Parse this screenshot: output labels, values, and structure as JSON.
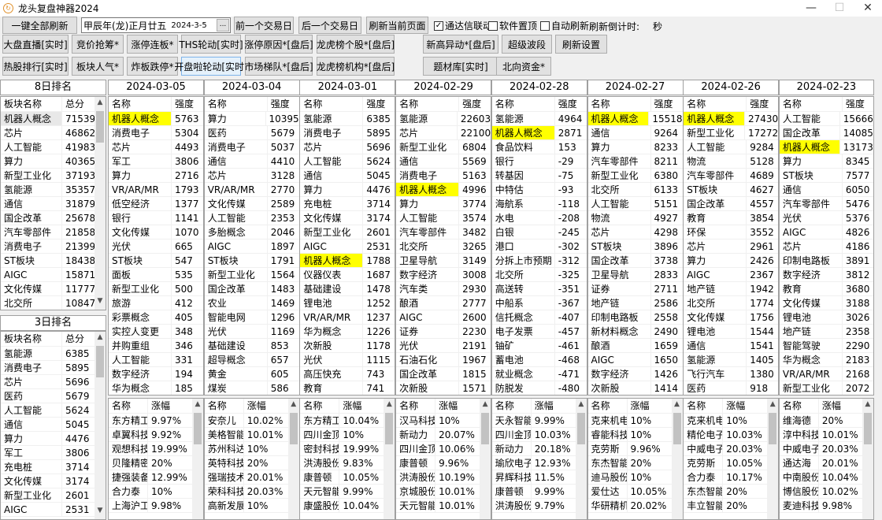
{
  "window": {
    "title": "龙头复盘神器2024",
    "icon": "app-icon",
    "minimize": "—",
    "maximize": "☐",
    "close": "✕"
  },
  "topbar": {
    "refresh_all": "一键全部刷新",
    "date_value": "甲辰年(龙)正月廿五",
    "date_small": "2024-3-5",
    "date_picker": "...",
    "prev_day": "前一个交易日",
    "next_day": "后一个交易日",
    "refresh_page": "刷新当前页面",
    "checkboxes": [
      {
        "label": "通达信联动",
        "checked": true
      },
      {
        "label": "软件置顶",
        "checked": false
      },
      {
        "label": "自动刷新",
        "checked": false
      }
    ],
    "countdown_label": "刷新倒计时:",
    "countdown_unit": "秒"
  },
  "toolbar_row1": [
    "大盘直播[实时]",
    "竞价抢筹*",
    "涨停连板*",
    "THS轮动[实时]",
    "涨停原因*[盘后]",
    "龙虎榜个股*[盘后]",
    "新高异动*[盘后]",
    "超级波段",
    "刷新设置"
  ],
  "toolbar_row2": [
    "热股排行[实时]",
    "板块人气*",
    "炸板跌停*",
    "开盘啦轮动[实时]",
    "市场梯队*[盘后]",
    "龙虎榜机构*[盘后]",
    "题材库[实时]",
    "北向资金*"
  ],
  "highlight_color": "#ffff00",
  "highlight_name": "机器人概念",
  "rank8": {
    "title": "8日排名",
    "headers": [
      "板块名称",
      "总分"
    ],
    "rows": [
      [
        "机器人概念",
        "71539"
      ],
      [
        "芯片",
        "46862"
      ],
      [
        "人工智能",
        "41983"
      ],
      [
        "算力",
        "40365"
      ],
      [
        "新型工业化",
        "37193"
      ],
      [
        "氢能源",
        "35357"
      ],
      [
        "通信",
        "31879"
      ],
      [
        "国企改革",
        "25678"
      ],
      [
        "汽车零部件",
        "21858"
      ],
      [
        "消费电子",
        "21399"
      ],
      [
        "ST板块",
        "18438"
      ],
      [
        "AIGC",
        "15871"
      ],
      [
        "文化传媒",
        "11777"
      ],
      [
        "北交所",
        "10847"
      ]
    ]
  },
  "rank3": {
    "title": "3日排名",
    "headers": [
      "板块名称",
      "总分"
    ],
    "rows": [
      [
        "氢能源",
        "6385"
      ],
      [
        "消费电子",
        "5895"
      ],
      [
        "芯片",
        "5696"
      ],
      [
        "医药",
        "5679"
      ],
      [
        "人工智能",
        "5624"
      ],
      [
        "通信",
        "5045"
      ],
      [
        "算力",
        "4476"
      ],
      [
        "军工",
        "3806"
      ],
      [
        "充电桩",
        "3714"
      ],
      [
        "文化传媒",
        "3174"
      ],
      [
        "新型工业化",
        "2601"
      ],
      [
        "AIGC",
        "2531"
      ]
    ]
  },
  "sector_headers": [
    "名称",
    "强度"
  ],
  "stock_headers": [
    "名称",
    "涨幅"
  ],
  "days": [
    {
      "date": "2024-03-05",
      "sectors": [
        [
          "机器人概念",
          "5763"
        ],
        [
          "消费电子",
          "5304"
        ],
        [
          "芯片",
          "4493"
        ],
        [
          "军工",
          "3806"
        ],
        [
          "算力",
          "2716"
        ],
        [
          "VR/AR/MR",
          "1793"
        ],
        [
          "低空经济",
          "1377"
        ],
        [
          "银行",
          "1141"
        ],
        [
          "文化传媒",
          "1070"
        ],
        [
          "光伏",
          "665"
        ],
        [
          "ST板块",
          "547"
        ],
        [
          "面板",
          "535"
        ],
        [
          "新型工业化",
          "500"
        ],
        [
          "旅游",
          "412"
        ],
        [
          "彩票概念",
          "405"
        ],
        [
          "实控人变更",
          "348"
        ],
        [
          "并购重组",
          "346"
        ],
        [
          "人工智能",
          "331"
        ],
        [
          "数字经济",
          "194"
        ],
        [
          "华为概念",
          "185"
        ]
      ],
      "stocks": [
        [
          "东方精工",
          "9.97%"
        ],
        [
          "卓翼科技",
          "9.92%"
        ],
        [
          "观想科技",
          "19.99%"
        ],
        [
          "贝隆精密",
          "20%"
        ],
        [
          "捷强装备",
          "12.99%"
        ],
        [
          "合力泰",
          "10%"
        ],
        [
          "上海沪工",
          "9.98%"
        ]
      ]
    },
    {
      "date": "2024-03-04",
      "sectors": [
        [
          "算力",
          "10395"
        ],
        [
          "医药",
          "5679"
        ],
        [
          "消费电子",
          "5037"
        ],
        [
          "通信",
          "4410"
        ],
        [
          "芯片",
          "3128"
        ],
        [
          "VR/AR/MR",
          "2770"
        ],
        [
          "文化传媒",
          "2589"
        ],
        [
          "人工智能",
          "2353"
        ],
        [
          "多胎概念",
          "2046"
        ],
        [
          "AIGC",
          "1897"
        ],
        [
          "ST板块",
          "1791"
        ],
        [
          "新型工业化",
          "1564"
        ],
        [
          "国企改革",
          "1483"
        ],
        [
          "农业",
          "1469"
        ],
        [
          "智能电网",
          "1296"
        ],
        [
          "光伏",
          "1169"
        ],
        [
          "基础建设",
          "853"
        ],
        [
          "超导概念",
          "657"
        ],
        [
          "黄金",
          "605"
        ],
        [
          "煤炭",
          "586"
        ]
      ],
      "stocks": [
        [
          "安奈儿",
          "10.02%"
        ],
        [
          "美格智能",
          "10.01%"
        ],
        [
          "苏州科达",
          "10%"
        ],
        [
          "英特科技",
          "20%"
        ],
        [
          "强瑞技术",
          "20.01%"
        ],
        [
          "荣科科技",
          "20.03%"
        ],
        [
          "高新发展",
          "10%"
        ]
      ]
    },
    {
      "date": "2024-03-01",
      "sectors": [
        [
          "氢能源",
          "6385"
        ],
        [
          "消费电子",
          "5895"
        ],
        [
          "芯片",
          "5696"
        ],
        [
          "人工智能",
          "5624"
        ],
        [
          "通信",
          "5045"
        ],
        [
          "算力",
          "4476"
        ],
        [
          "充电桩",
          "3714"
        ],
        [
          "文化传媒",
          "3174"
        ],
        [
          "新型工业化",
          "2601"
        ],
        [
          "AIGC",
          "2531"
        ],
        [
          "机器人概念",
          "1788"
        ],
        [
          "仪器仪表",
          "1687"
        ],
        [
          "基础建设",
          "1478"
        ],
        [
          "锂电池",
          "1252"
        ],
        [
          "VR/AR/MR",
          "1237"
        ],
        [
          "华为概念",
          "1226"
        ],
        [
          "次新股",
          "1178"
        ],
        [
          "光伏",
          "1115"
        ],
        [
          "高压快充",
          "743"
        ],
        [
          "教育",
          "741"
        ]
      ],
      "stocks": [
        [
          "东方精工",
          "10.04%"
        ],
        [
          "四川金顶",
          "10%"
        ],
        [
          "密封科技",
          "19.99%"
        ],
        [
          "洪涛股份",
          "9.83%"
        ],
        [
          "康普顿",
          "10.05%"
        ],
        [
          "天元智能",
          "9.99%"
        ],
        [
          "康盛股份",
          "10.04%"
        ]
      ]
    },
    {
      "date": "2024-02-29",
      "sectors": [
        [
          "氢能源",
          "22603"
        ],
        [
          "芯片",
          "22100"
        ],
        [
          "新型工业化",
          "6804"
        ],
        [
          "通信",
          "5569"
        ],
        [
          "消费电子",
          "5163"
        ],
        [
          "机器人概念",
          "4996"
        ],
        [
          "算力",
          "3774"
        ],
        [
          "人工智能",
          "3574"
        ],
        [
          "汽车零部件",
          "3482"
        ],
        [
          "北交所",
          "3265"
        ],
        [
          "卫星导航",
          "3149"
        ],
        [
          "数字经济",
          "3008"
        ],
        [
          "汽车类",
          "2930"
        ],
        [
          "酿酒",
          "2777"
        ],
        [
          "AIGC",
          "2600"
        ],
        [
          "证券",
          "2230"
        ],
        [
          "光伏",
          "2191"
        ],
        [
          "石油石化",
          "1967"
        ],
        [
          "国企改革",
          "1815"
        ],
        [
          "次新股",
          "1571"
        ]
      ],
      "stocks": [
        [
          "汉马科技",
          "10%"
        ],
        [
          "新动力",
          "20.07%"
        ],
        [
          "四川金顶",
          "10.06%"
        ],
        [
          "康普顿",
          "9.96%"
        ],
        [
          "洪涛股份",
          "10.19%"
        ],
        [
          "京城股份",
          "10.01%"
        ],
        [
          "天元智能",
          "10.01%"
        ]
      ]
    },
    {
      "date": "2024-02-28",
      "sectors": [
        [
          "氢能源",
          "4964"
        ],
        [
          "机器人概念",
          "2871"
        ],
        [
          "食品饮料",
          "153"
        ],
        [
          "银行",
          "-29"
        ],
        [
          "转基因",
          "-75"
        ],
        [
          "中特估",
          "-93"
        ],
        [
          "海航系",
          "-118"
        ],
        [
          "水电",
          "-208"
        ],
        [
          "白银",
          "-245"
        ],
        [
          "港口",
          "-302"
        ],
        [
          "分拆上市预期",
          "-312"
        ],
        [
          "北交所",
          "-325"
        ],
        [
          "高送转",
          "-351"
        ],
        [
          "中船系",
          "-367"
        ],
        [
          "信托概念",
          "-407"
        ],
        [
          "电子发票",
          "-457"
        ],
        [
          "铀矿",
          "-461"
        ],
        [
          "蓄电池",
          "-468"
        ],
        [
          "就业概念",
          "-471"
        ],
        [
          "防脱发",
          "-480"
        ]
      ],
      "stocks": [
        [
          "天永智能",
          "9.99%"
        ],
        [
          "四川金顶",
          "10.03%"
        ],
        [
          "新动力",
          "20.18%"
        ],
        [
          "瑜欣电子",
          "12.93%"
        ],
        [
          "昇辉科技",
          "11.5%"
        ],
        [
          "康普顿",
          "9.99%"
        ],
        [
          "洪涛股份",
          "9.79%"
        ]
      ]
    },
    {
      "date": "2024-02-27",
      "sectors": [
        [
          "机器人概念",
          "15518"
        ],
        [
          "通信",
          "9264"
        ],
        [
          "算力",
          "8233"
        ],
        [
          "汽车零部件",
          "8211"
        ],
        [
          "新型工业化",
          "6380"
        ],
        [
          "北交所",
          "6133"
        ],
        [
          "人工智能",
          "5151"
        ],
        [
          "物流",
          "4927"
        ],
        [
          "芯片",
          "4298"
        ],
        [
          "ST板块",
          "3896"
        ],
        [
          "国企改革",
          "3738"
        ],
        [
          "卫星导航",
          "2833"
        ],
        [
          "证券",
          "2711"
        ],
        [
          "地产链",
          "2586"
        ],
        [
          "印制电路板",
          "2558"
        ],
        [
          "新材料概念",
          "2490"
        ],
        [
          "酿酒",
          "1659"
        ],
        [
          "AIGC",
          "1650"
        ],
        [
          "数字经济",
          "1426"
        ],
        [
          "次新股",
          "1414"
        ]
      ],
      "stocks": [
        [
          "克来机电",
          "10%"
        ],
        [
          "睿能科技",
          "10%"
        ],
        [
          "克劳斯",
          "9.96%"
        ],
        [
          "东杰智能",
          "20%"
        ],
        [
          "迪马股份",
          "10%"
        ],
        [
          "爱仕达",
          "10.05%"
        ],
        [
          "华研精机",
          "20.02%"
        ]
      ]
    },
    {
      "date": "2024-02-26",
      "sectors": [
        [
          "机器人概念",
          "27430"
        ],
        [
          "新型工业化",
          "17272"
        ],
        [
          "人工智能",
          "9284"
        ],
        [
          "物流",
          "5128"
        ],
        [
          "汽车零部件",
          "4689"
        ],
        [
          "ST板块",
          "4627"
        ],
        [
          "国企改革",
          "4557"
        ],
        [
          "教育",
          "3854"
        ],
        [
          "环保",
          "3552"
        ],
        [
          "芯片",
          "2961"
        ],
        [
          "算力",
          "2426"
        ],
        [
          "AIGC",
          "2367"
        ],
        [
          "地产链",
          "1942"
        ],
        [
          "北交所",
          "1774"
        ],
        [
          "文化传媒",
          "1756"
        ],
        [
          "锂电池",
          "1544"
        ],
        [
          "通信",
          "1541"
        ],
        [
          "氢能源",
          "1405"
        ],
        [
          "飞行汽车",
          "1380"
        ],
        [
          "医药",
          "918"
        ]
      ],
      "stocks": [
        [
          "克来机电",
          "10%"
        ],
        [
          "精伦电子",
          "10.03%"
        ],
        [
          "中威电子",
          "20.03%"
        ],
        [
          "克劳斯",
          "10.05%"
        ],
        [
          "合力泰",
          "10.17%"
        ],
        [
          "东杰智能",
          "20%"
        ],
        [
          "丰立智能",
          "20%"
        ]
      ]
    },
    {
      "date": "2024-02-23",
      "sectors": [
        [
          "人工智能",
          "15666"
        ],
        [
          "国企改革",
          "14085"
        ],
        [
          "机器人概念",
          "13173"
        ],
        [
          "算力",
          "8345"
        ],
        [
          "ST板块",
          "7577"
        ],
        [
          "通信",
          "6050"
        ],
        [
          "汽车零部件",
          "5476"
        ],
        [
          "光伏",
          "5376"
        ],
        [
          "AIGC",
          "4826"
        ],
        [
          "芯片",
          "4186"
        ],
        [
          "印制电路板",
          "3891"
        ],
        [
          "数字经济",
          "3812"
        ],
        [
          "教育",
          "3680"
        ],
        [
          "文化传媒",
          "3188"
        ],
        [
          "锂电池",
          "3026"
        ],
        [
          "地产链",
          "2358"
        ],
        [
          "智能驾驶",
          "2290"
        ],
        [
          "华为概念",
          "2183"
        ],
        [
          "VR/AR/MR",
          "2168"
        ],
        [
          "新型工业化",
          "2072"
        ]
      ],
      "stocks": [
        [
          "维海德",
          "20%"
        ],
        [
          "淳中科技",
          "10.01%"
        ],
        [
          "中威电子",
          "20.03%"
        ],
        [
          "通达海",
          "20.01%"
        ],
        [
          "中南股份",
          "10.04%"
        ],
        [
          "博信股份",
          "10.02%"
        ],
        [
          "麦迪科技",
          "9.98%"
        ]
      ]
    }
  ]
}
